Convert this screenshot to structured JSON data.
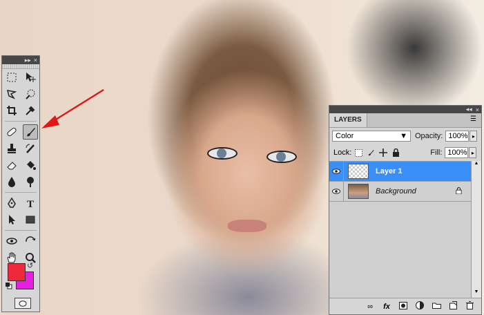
{
  "tools_panel": {
    "header_glyphs": [
      "▸▸",
      "×"
    ],
    "tools": [
      [
        "marquee-tool",
        "move-tool"
      ],
      [
        "lasso-tool",
        "quick-selection-tool"
      ],
      [
        "crop-tool",
        "eyedropper-tool"
      ],
      [
        "spot-healing-brush-tool",
        "brush-tool"
      ],
      [
        "clone-stamp-tool",
        "history-brush-tool"
      ],
      [
        "eraser-tool",
        "paint-bucket-tool"
      ],
      [
        "blur-tool",
        "dodge-tool"
      ],
      [
        "pen-tool",
        "type-tool"
      ],
      [
        "path-selection-tool",
        "rectangle-tool"
      ],
      [
        "3d-rotate-tool",
        "3d-orbit-tool"
      ],
      [
        "hand-tool",
        "zoom-tool"
      ]
    ],
    "active_tool": "brush-tool",
    "foreground_color": "#f0283c",
    "background_color": "#e81ee0"
  },
  "layers_panel": {
    "header_glyphs": [
      "◂◂",
      "×"
    ],
    "tab": "LAYERS",
    "blend_mode": "Color",
    "opacity_label": "Opacity:",
    "opacity": "100%",
    "lock_label": "Lock:",
    "fill_label": "Fill:",
    "fill": "100%",
    "layers": [
      {
        "name": "Layer 1",
        "selected": true
      },
      {
        "name": "Background",
        "selected": false,
        "locked": true
      }
    ],
    "bottom_icons": [
      "link-icon",
      "fx-icon",
      "mask-icon",
      "adjustment-icon",
      "group-icon",
      "new-layer-icon",
      "trash-icon"
    ],
    "fx_label": "fx"
  },
  "colors": {
    "selection": "#3a8ff6",
    "arrow": "#e01818",
    "panel": "#d6d6d6"
  }
}
